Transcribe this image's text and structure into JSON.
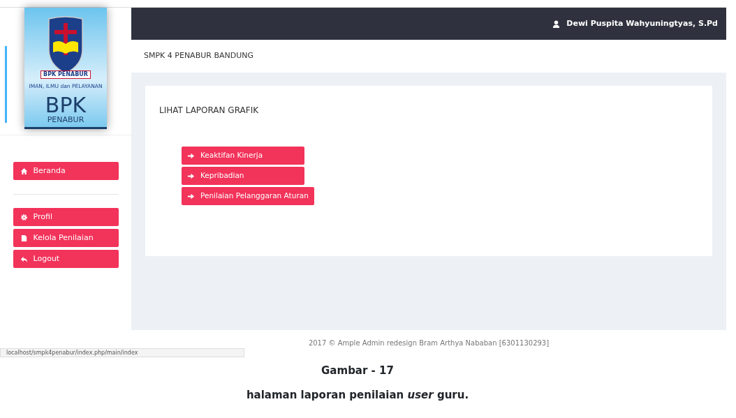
{
  "logo": {
    "ribbon": "BPK PENABUR",
    "motto": "IMAN, ILMU dan PELAYANAN",
    "title": "BPK",
    "subtitle": "PENABUR"
  },
  "topbar": {
    "user": "Dewi Puspita Wahyuningtyas, S.Pd"
  },
  "breadcrumb": "SMPK 4 PENABUR BANDUNG",
  "sidebar": {
    "groups": [
      [
        {
          "label": "Beranda",
          "kind": "home"
        }
      ],
      [
        {
          "label": "Profil",
          "kind": "profile"
        },
        {
          "label": "Kelola Penilaian",
          "kind": "manage"
        },
        {
          "label": "Logout",
          "kind": "logout"
        }
      ]
    ]
  },
  "panel": {
    "title": "LIHAT LAPORAN GRAFIK",
    "buttons": [
      {
        "label": "Keaktifan Kinerja"
      },
      {
        "label": "Kepribadian"
      },
      {
        "label": "Penilaian Pelanggaran Aturan"
      }
    ]
  },
  "footer": "2017 © Ample Admin redesign Bram Arthya Nababan [6301130293]",
  "status_url": "localhost/smpk4penabur/index.php/main/index",
  "caption": {
    "title": "Gambar  - 17",
    "text": "halaman laporan penilaian *user* guru."
  }
}
